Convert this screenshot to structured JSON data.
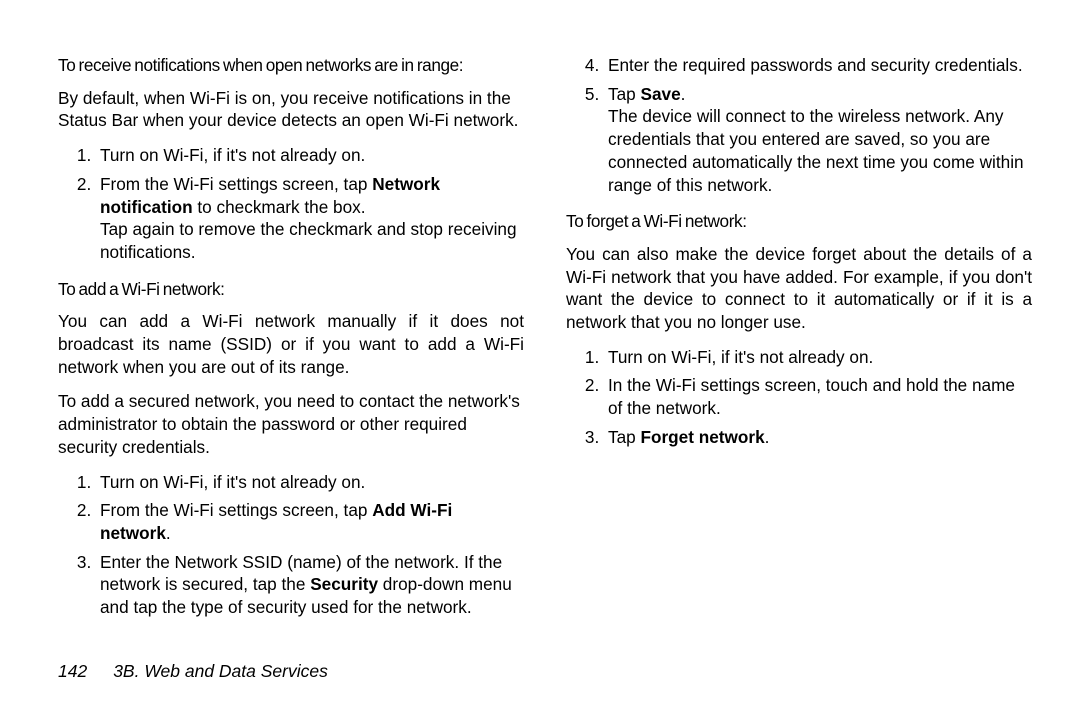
{
  "footer": {
    "page_number": "142",
    "section": "3B. Web and Data Services"
  },
  "sections": {
    "notify": {
      "heading": "To receive notifications when open networks are in range:",
      "intro": "By default, when Wi-Fi is on, you receive notifications in the Status Bar when your device detects an open Wi-Fi network.",
      "steps": {
        "s1": "Turn on Wi-Fi, if it's not already on.",
        "s2_pre": "From the Wi-Fi settings screen, tap ",
        "s2_bold": "Network notification",
        "s2_post": " to checkmark the box.",
        "s2_sub": "Tap again to remove the checkmark and stop receiving notifications."
      }
    },
    "add": {
      "heading": "To add a Wi-Fi network:",
      "p1": "You can add a Wi-Fi network manually if it does not broadcast its name (SSID) or if you want to add a Wi-Fi network when you are out of its range.",
      "p2": "To add a secured network, you need to contact the network's administrator to obtain the password or other required security credentials.",
      "steps": {
        "s1": "Turn on Wi-Fi, if it's not already on.",
        "s2_pre": "From the Wi-Fi settings screen, tap ",
        "s2_bold": "Add Wi-Fi network",
        "s2_post": ".",
        "s3_pre": "Enter the Network SSID (name) of the network. If the network is secured, tap the ",
        "s3_bold": "Security",
        "s3_post": " drop-down menu and tap the type of security used for the network.",
        "s4": "Enter the required passwords and security credentials.",
        "s5_pre": "Tap ",
        "s5_bold": "Save",
        "s5_post": ".",
        "s5_sub": "The device will connect to the wireless network. Any credentials that you entered are saved, so you are connected automatically the next time you come within range of this network."
      }
    },
    "forget": {
      "heading": "To forget a Wi-Fi network:",
      "p1": "You can also make the device forget about the details of a Wi-Fi network that you have added. For example, if you don't want the device to connect to it automatically or if it is a network that you no longer use.",
      "steps": {
        "s1": "Turn on Wi-Fi, if it's not already on.",
        "s2": "In the Wi-Fi settings screen, touch and hold the name of the network.",
        "s3_pre": "Tap ",
        "s3_bold": "Forget network",
        "s3_post": "."
      }
    }
  }
}
